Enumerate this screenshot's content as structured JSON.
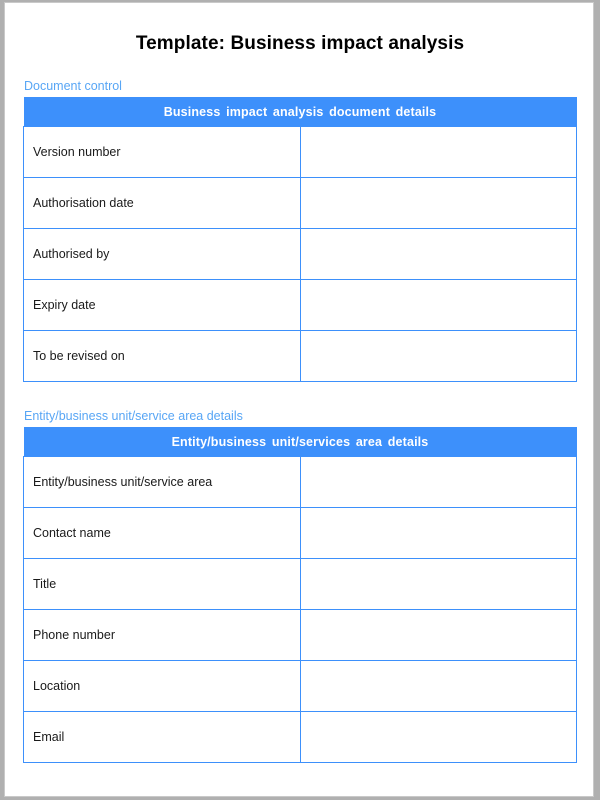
{
  "document": {
    "title": "Template: Business impact analysis"
  },
  "sections": [
    {
      "label": "Document control",
      "banner": "Business impact analysis document details",
      "rows": [
        {
          "label": "Version number",
          "value": ""
        },
        {
          "label": "Authorisation date",
          "value": ""
        },
        {
          "label": "Authorised by",
          "value": ""
        },
        {
          "label": "Expiry date",
          "value": ""
        },
        {
          "label": "To be revised on",
          "value": ""
        }
      ]
    },
    {
      "label": "Entity/business unit/service area details",
      "banner": "Entity/business unit/services area details",
      "rows": [
        {
          "label": "Entity/business unit/service area",
          "value": ""
        },
        {
          "label": "Contact name",
          "value": ""
        },
        {
          "label": "Title",
          "value": ""
        },
        {
          "label": "Phone number",
          "value": ""
        },
        {
          "label": "Location",
          "value": ""
        },
        {
          "label": "Email",
          "value": ""
        }
      ]
    }
  ],
  "colors": {
    "banner_background": "#3d90fb",
    "banner_text": "#ffffff",
    "border": "#3d90fb",
    "section_label": "#58a6f5",
    "title_text": "#000000",
    "page_background": "#ffffff",
    "canvas_background": "#b0b0b0"
  }
}
